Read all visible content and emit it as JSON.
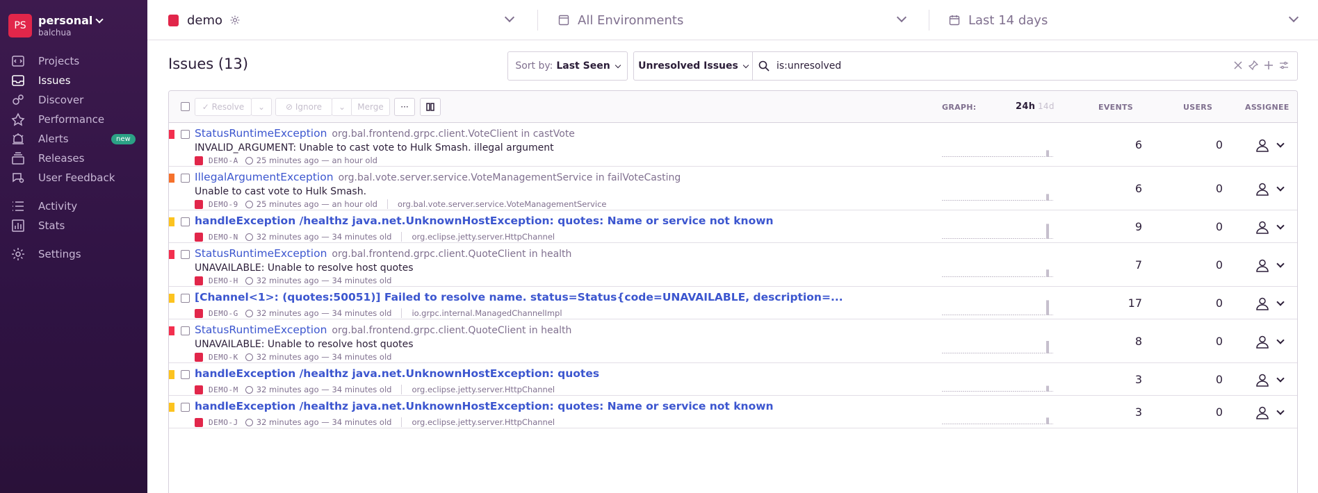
{
  "org": {
    "avatar": "PS",
    "name": "personal",
    "user": "balchua"
  },
  "nav": [
    {
      "label": "Projects",
      "icon": "projects-icon"
    },
    {
      "label": "Issues",
      "icon": "issues-icon",
      "active": true
    },
    {
      "label": "Discover",
      "icon": "discover-icon"
    },
    {
      "label": "Performance",
      "icon": "performance-icon"
    },
    {
      "label": "Alerts",
      "icon": "alerts-icon",
      "badge": "new"
    },
    {
      "label": "Releases",
      "icon": "releases-icon"
    },
    {
      "label": "User Feedback",
      "icon": "user-feedback-icon"
    },
    {
      "label": "Activity",
      "icon": "activity-icon"
    },
    {
      "label": "Stats",
      "icon": "stats-icon"
    },
    {
      "label": "Settings",
      "icon": "settings-icon"
    }
  ],
  "header": {
    "project": "demo",
    "environment": "All Environments",
    "time_range": "Last 14 days"
  },
  "issues": {
    "title": "Issues (13)",
    "sort_label": "Sort by:",
    "sort_value": "Last Seen",
    "saved_search": "Unresolved Issues",
    "query": "is:unresolved"
  },
  "toolbar": {
    "resolve": "Resolve",
    "ignore": "Ignore",
    "merge": "Merge",
    "more": "···"
  },
  "columns": {
    "graph": "GRAPH:",
    "graph_24h": "24h",
    "graph_14d": "14d",
    "events": "EVENTS",
    "users": "USERS",
    "assignee": "ASSIGNEE"
  },
  "colors": {
    "accent": "#3c56cf",
    "sidebar": "#3d1a4e",
    "priority_red": "#f32f4e",
    "priority_orange": "#f5712c",
    "priority_yellow": "#fcc31f"
  },
  "rows": [
    {
      "type": "StatusRuntimeException",
      "bold": false,
      "culprit": "org.bal.frontend.grpc.client.VoteClient in castVote",
      "message": "INVALID_ARGUMENT: Unable to cast vote to Hulk Smash. illegal argument",
      "short_id": "DEMO-A",
      "time": "25 minutes ago — an hour old",
      "logger": "",
      "events": "6",
      "users": "0",
      "priority": "#f32f4e"
    },
    {
      "type": "IllegalArgumentException",
      "bold": false,
      "culprit": "org.bal.vote.server.service.VoteManagementService in failVoteCasting",
      "message": "Unable to cast vote to Hulk Smash.",
      "short_id": "DEMO-9",
      "time": "25 minutes ago — an hour old",
      "logger": "org.bal.vote.server.service.VoteManagementService",
      "events": "6",
      "users": "0",
      "priority": "#f5712c"
    },
    {
      "type": "handleException /healthz java.net.UnknownHostException: quotes: Name or service not known",
      "bold": true,
      "culprit": "",
      "message": "",
      "short_id": "DEMO-N",
      "time": "32 minutes ago — 34 minutes old",
      "logger": "org.eclipse.jetty.server.HttpChannel",
      "events": "9",
      "users": "0",
      "priority": "#fcc31f"
    },
    {
      "type": "StatusRuntimeException",
      "bold": false,
      "culprit": "org.bal.frontend.grpc.client.QuoteClient in health",
      "message": "UNAVAILABLE: Unable to resolve host quotes",
      "short_id": "DEMO-H",
      "time": "32 minutes ago — 34 minutes old",
      "logger": "",
      "events": "7",
      "users": "0",
      "priority": "#f32f4e"
    },
    {
      "type": "[Channel<1>: (quotes:50051)] Failed to resolve name. status=Status{code=UNAVAILABLE, description=...",
      "bold": true,
      "culprit": "",
      "message": "",
      "short_id": "DEMO-G",
      "time": "32 minutes ago — 34 minutes old",
      "logger": "io.grpc.internal.ManagedChannelImpl",
      "events": "17",
      "users": "0",
      "priority": "#fcc31f"
    },
    {
      "type": "StatusRuntimeException",
      "bold": false,
      "culprit": "org.bal.frontend.grpc.client.QuoteClient in health",
      "message": "UNAVAILABLE: Unable to resolve host quotes",
      "short_id": "DEMO-K",
      "time": "32 minutes ago — 34 minutes old",
      "logger": "",
      "events": "8",
      "users": "0",
      "priority": "#f32f4e"
    },
    {
      "type": "handleException /healthz java.net.UnknownHostException: quotes",
      "bold": true,
      "culprit": "",
      "message": "",
      "short_id": "DEMO-M",
      "time": "32 minutes ago — 34 minutes old",
      "logger": "org.eclipse.jetty.server.HttpChannel",
      "events": "3",
      "users": "0",
      "priority": "#fcc31f"
    },
    {
      "type": "handleException /healthz java.net.UnknownHostException: quotes: Name or service not known",
      "bold": true,
      "culprit": "",
      "message": "",
      "short_id": "DEMO-J",
      "time": "32 minutes ago — 34 minutes old",
      "logger": "org.eclipse.jetty.server.HttpChannel",
      "events": "3",
      "users": "0",
      "priority": "#fcc31f"
    }
  ],
  "sparklines": [
    0.4,
    0.4,
    0.9,
    0.45,
    0.9,
    0.75,
    0.35,
    0.4
  ]
}
